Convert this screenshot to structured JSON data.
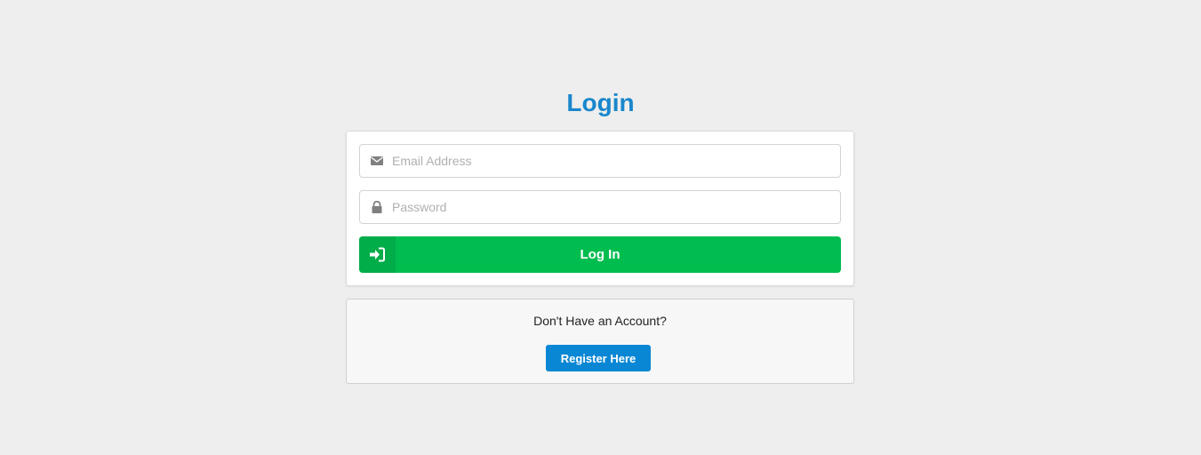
{
  "page": {
    "title": "Login"
  },
  "login_form": {
    "email": {
      "placeholder": "Email Address",
      "value": "",
      "icon": "envelope-icon"
    },
    "password": {
      "placeholder": "Password",
      "value": "",
      "icon": "lock-icon"
    },
    "submit": {
      "label": "Log In",
      "icon": "sign-in-icon",
      "color": "#00bd50"
    }
  },
  "register": {
    "prompt": "Don't Have an Account?",
    "button_label": "Register Here",
    "color": "#0a87d4"
  },
  "colors": {
    "accent": "#1a87cc",
    "background": "#eeeeee"
  }
}
